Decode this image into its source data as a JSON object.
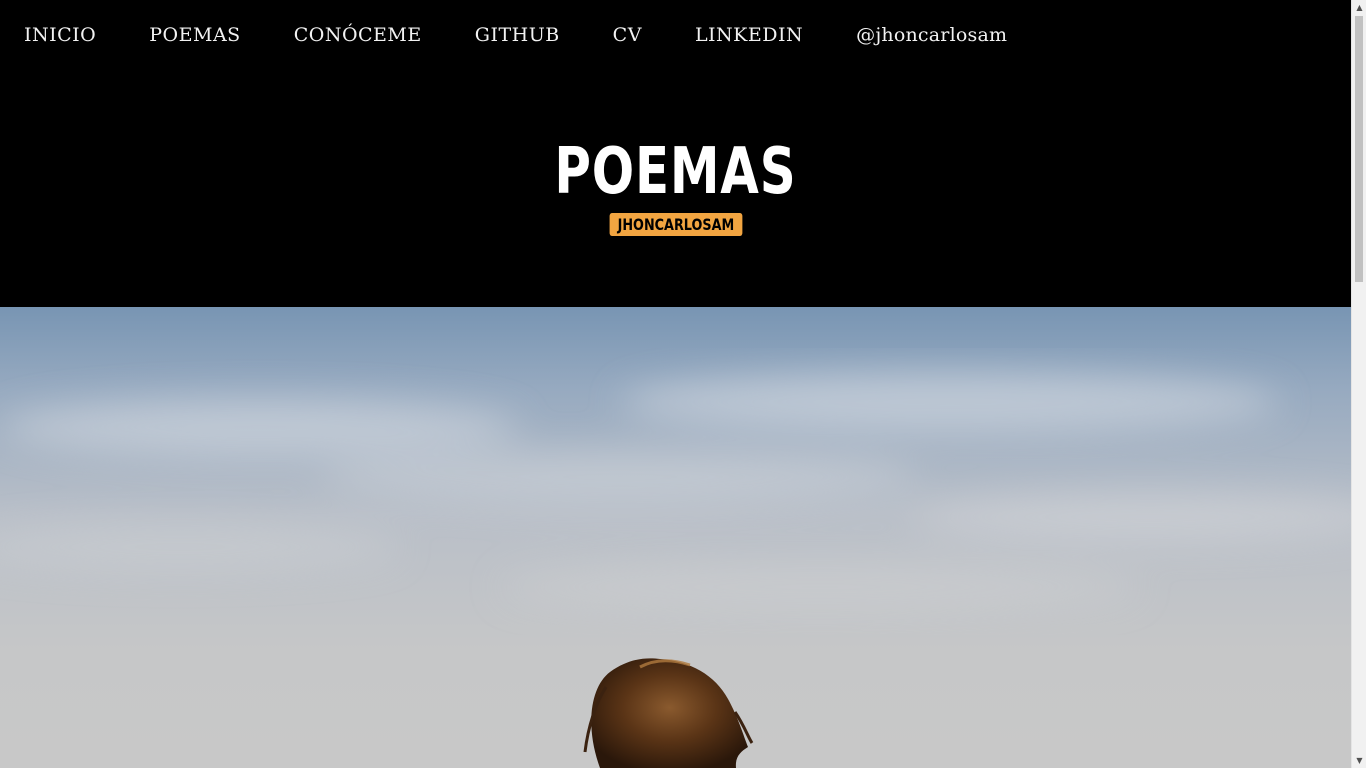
{
  "nav": {
    "items": [
      {
        "label": "INICIO"
      },
      {
        "label": "POEMAS"
      },
      {
        "label": "CONÓCEME"
      },
      {
        "label": "GITHUB"
      },
      {
        "label": "CV"
      },
      {
        "label": "LINKEDIN"
      },
      {
        "label": "@jhoncarlosam"
      }
    ]
  },
  "header": {
    "title": "POEMAS",
    "badge": "JHONCARLOSAM"
  },
  "colors": {
    "background": "#000000",
    "text": "#ffffff",
    "badge": "#f2a541",
    "sky_top": "#7b97b5",
    "sky_bottom": "#c9c9c9"
  },
  "icons": {
    "scroll_up": "triangle-up-icon",
    "scroll_down": "triangle-down-icon"
  },
  "scroll": {
    "position_fraction": 0
  }
}
